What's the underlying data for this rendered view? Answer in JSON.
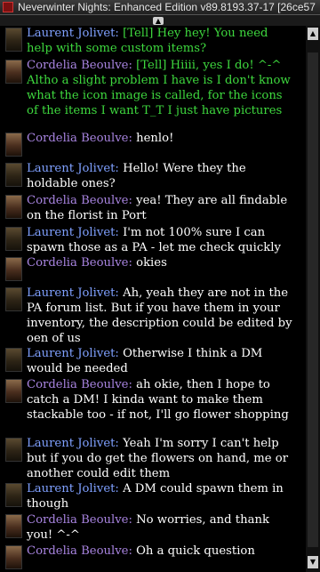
{
  "window": {
    "title": "Neverwinter Nights: Enhanced Edition v89.8193.37-17 [26ce57"
  },
  "chat": {
    "messages": [
      {
        "speaker": "Laurent Jolivet:",
        "tell": "[Tell] Hey hey! You need help with some custom items?",
        "text": ""
      },
      {
        "speaker": "Cordelia Beoulve:",
        "tell": "[Tell] Hiiii, yes I do! ^-^ Altho a slight problem I have is I don't know what the icon image is called, for the icons of the items I want T_T I just have pictures",
        "text": ""
      },
      {
        "speaker": "Cordelia Beoulve:",
        "tell": "",
        "text": "henlo!"
      },
      {
        "speaker": "Laurent Jolivet:",
        "tell": "",
        "text": "Hello! Were they the holdable ones?"
      },
      {
        "speaker": "Cordelia Beoulve:",
        "tell": "",
        "text": "yea! They are all findable on the florist in Port"
      },
      {
        "speaker": "Laurent Jolivet:",
        "tell": "",
        "text": "I'm not 100% sure I can spawn those as a PA - let me check quickly"
      },
      {
        "speaker": "Cordelia Beoulve:",
        "tell": "",
        "text": "okies"
      },
      {
        "speaker": "Laurent Jolivet:",
        "tell": "",
        "text": "Ah, yeah they are not in the PA forum list. But if you have them in your inventory, the description could be edited by oen of us"
      },
      {
        "speaker": "Laurent Jolivet:",
        "tell": "",
        "text": "Otherwise I think a DM would be needed"
      },
      {
        "speaker": "Cordelia Beoulve:",
        "tell": "",
        "text": "ah okie, then I hope to catch a DM! I kinda want to make them stackable too - if not, I'll go flower shopping"
      },
      {
        "speaker": "Laurent Jolivet:",
        "tell": "",
        "text": "Yeah I'm sorry I can't help but if you do get the flowers on hand, me or another could edit them"
      },
      {
        "speaker": "Laurent Jolivet:",
        "tell": "",
        "text": "A DM could spawn them in though"
      },
      {
        "speaker": "Cordelia Beoulve:",
        "tell": "",
        "text": "No worries, and thank you! ^-^"
      },
      {
        "speaker": "Cordelia Beoulve:",
        "tell": "",
        "text": "Oh a quick question"
      }
    ]
  },
  "colors": {
    "laurent": "#7fa0ff",
    "cordelia": "#a884e0",
    "tell": "#3ed83e",
    "text": "#ffffff"
  },
  "icons": {
    "app": "nwn-icon",
    "collapse": "chevron-up-icon",
    "scroll_up": "scroll-up-arrow-icon",
    "scroll_down": "scroll-down-arrow-icon"
  }
}
